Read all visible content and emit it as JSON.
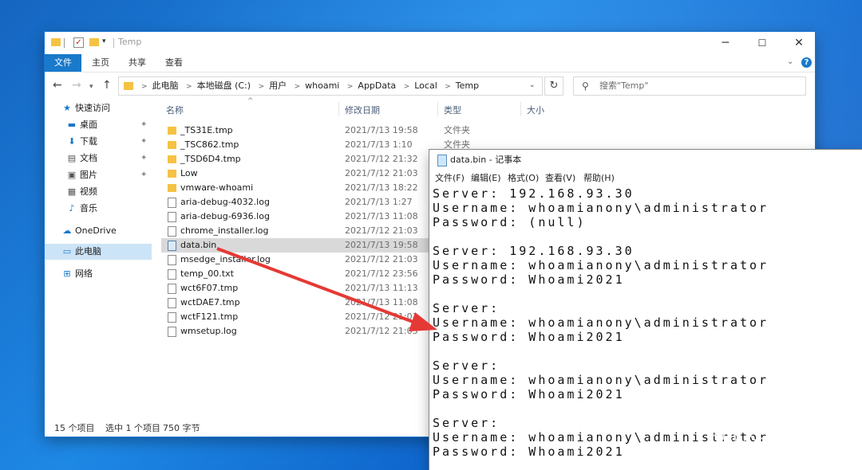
{
  "explorer": {
    "title": "Temp",
    "ribbon_tabs": [
      "文件",
      "主页",
      "共享",
      "查看"
    ],
    "breadcrumbs": [
      "此电脑",
      "本地磁盘 (C:)",
      "用户",
      "whoami",
      "AppData",
      "Local",
      "Temp"
    ],
    "search_placeholder": "搜索\"Temp\"",
    "nav": {
      "quick_access": "快速访问",
      "desktop": "桌面",
      "downloads": "下载",
      "documents": "文档",
      "pictures": "图片",
      "videos": "视频",
      "music": "音乐",
      "onedrive": "OneDrive",
      "this_pc": "此电脑",
      "network": "网络"
    },
    "columns": {
      "name": "名称",
      "date": "修改日期",
      "type": "类型",
      "size": "大小"
    },
    "files": [
      {
        "name": "_TS31E.tmp",
        "date": "2021/7/13 19:58",
        "type": "文件夹"
      },
      {
        "name": "_TSC862.tmp",
        "date": "2021/7/13 1:10",
        "type": "文件夹"
      },
      {
        "name": "_TSD6D4.tmp",
        "date": "2021/7/12 21:32",
        "type": ""
      },
      {
        "name": "Low",
        "date": "2021/7/12 21:03",
        "type": ""
      },
      {
        "name": "vmware-whoami",
        "date": "2021/7/13 18:22",
        "type": ""
      },
      {
        "name": "aria-debug-4032.log",
        "date": "2021/7/13 1:27",
        "type": ""
      },
      {
        "name": "aria-debug-6936.log",
        "date": "2021/7/13 11:08",
        "type": ""
      },
      {
        "name": "chrome_installer.log",
        "date": "2021/7/12 21:03",
        "type": ""
      },
      {
        "name": "data.bin",
        "date": "2021/7/13 19:58",
        "type": ""
      },
      {
        "name": "msedge_installer.log",
        "date": "2021/7/12 21:03",
        "type": ""
      },
      {
        "name": "temp_00.txt",
        "date": "2021/7/12 23:56",
        "type": ""
      },
      {
        "name": "wct6F07.tmp",
        "date": "2021/7/13 11:13",
        "type": ""
      },
      {
        "name": "wctDAE7.tmp",
        "date": "2021/7/13 11:08",
        "type": ""
      },
      {
        "name": "wctF121.tmp",
        "date": "2021/7/12 21:03",
        "type": ""
      },
      {
        "name": "wmsetup.log",
        "date": "2021/7/12 21:03",
        "type": ""
      }
    ],
    "status": {
      "count": "15 个项目",
      "selected": "选中 1 个项目",
      "size": "750 字节"
    }
  },
  "notepad": {
    "title": "data.bin - 记事本",
    "menu": [
      "文件(F)",
      "编辑(E)",
      "格式(O)",
      "查看(V)",
      "帮助(H)"
    ],
    "lines": [
      "Server: 192.168.93.30",
      "Username: whoamianony\\administrator",
      "Password: (null)",
      "",
      "Server: 192.168.93.30",
      "Username: whoamianony\\administrator",
      "Password: Whoami2021",
      "",
      "Server:",
      "Username: whoamianony\\administrator",
      "Password: Whoami2021",
      "",
      "Server:",
      "Username: whoamianony\\administrator",
      "Password: Whoami2021",
      "",
      "Server:",
      "Username: whoamianony\\administrator",
      "Password: Whoami2021"
    ]
  },
  "watermark": "HACK学习呀",
  "colors": {
    "accent": "#1979ca",
    "arrow": "#e53935",
    "selected_row": "#d9d9d9",
    "nav_selected": "#cce4f7"
  }
}
